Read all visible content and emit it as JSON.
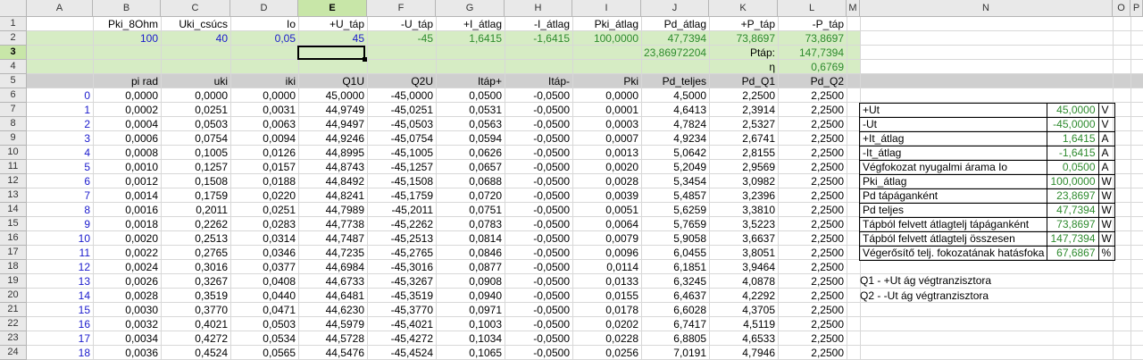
{
  "columns": [
    "A",
    "B",
    "C",
    "D",
    "E",
    "F",
    "G",
    "H",
    "I",
    "J",
    "K",
    "L",
    "M",
    "N",
    "O",
    "P"
  ],
  "rows": [
    "1",
    "2",
    "3",
    "4",
    "5",
    "6",
    "7",
    "8",
    "9",
    "10",
    "11",
    "12",
    "13",
    "14",
    "15",
    "16",
    "17",
    "18",
    "19",
    "20",
    "21",
    "22",
    "23",
    "24"
  ],
  "selected_column": "E",
  "selected_row": "3",
  "row1_headers": [
    "Pki_8Ohm",
    "Uki_csúcs",
    "Io",
    "+U_táp",
    "-U_táp",
    "+I_átlag",
    "-I_átlag",
    "Pki_átlag",
    "Pd_átlag",
    "+P_táp",
    "-P_táp"
  ],
  "row2_values": [
    "100",
    "40",
    "0,05",
    "45",
    "-45",
    "1,6415",
    "-1,6415",
    "100,0000",
    "47,7394",
    "73,8697",
    "73,8697"
  ],
  "row3": {
    "j": "23,86972204",
    "k_label": "Ptáp:",
    "l": "147,7394"
  },
  "row4": {
    "k_label": "η",
    "l": "0,6769"
  },
  "row5_headers": [
    "pi rad",
    "uki",
    "iki",
    "Q1U",
    "Q2U",
    "Itáp+",
    "Itáp-",
    "Pki",
    "Pd_teljes",
    "Pd_Q1",
    "Pd_Q2"
  ],
  "table_rows": [
    [
      "0",
      "0,0000",
      "0,0000",
      "0,0000",
      "45,0000",
      "-45,0000",
      "0,0500",
      "-0,0500",
      "0,0000",
      "4,5000",
      "2,2500",
      "2,2500"
    ],
    [
      "1",
      "0,0002",
      "0,0251",
      "0,0031",
      "44,9749",
      "-45,0251",
      "0,0531",
      "-0,0500",
      "0,0001",
      "4,6413",
      "2,3914",
      "2,2500"
    ],
    [
      "2",
      "0,0004",
      "0,0503",
      "0,0063",
      "44,9497",
      "-45,0503",
      "0,0563",
      "-0,0500",
      "0,0003",
      "4,7824",
      "2,5327",
      "2,2500"
    ],
    [
      "3",
      "0,0006",
      "0,0754",
      "0,0094",
      "44,9246",
      "-45,0754",
      "0,0594",
      "-0,0500",
      "0,0007",
      "4,9234",
      "2,6741",
      "2,2500"
    ],
    [
      "4",
      "0,0008",
      "0,1005",
      "0,0126",
      "44,8995",
      "-45,1005",
      "0,0626",
      "-0,0500",
      "0,0013",
      "5,0642",
      "2,8155",
      "2,2500"
    ],
    [
      "5",
      "0,0010",
      "0,1257",
      "0,0157",
      "44,8743",
      "-45,1257",
      "0,0657",
      "-0,0500",
      "0,0020",
      "5,2049",
      "2,9569",
      "2,2500"
    ],
    [
      "6",
      "0,0012",
      "0,1508",
      "0,0188",
      "44,8492",
      "-45,1508",
      "0,0688",
      "-0,0500",
      "0,0028",
      "5,3454",
      "3,0982",
      "2,2500"
    ],
    [
      "7",
      "0,0014",
      "0,1759",
      "0,0220",
      "44,8241",
      "-45,1759",
      "0,0720",
      "-0,0500",
      "0,0039",
      "5,4857",
      "3,2396",
      "2,2500"
    ],
    [
      "8",
      "0,0016",
      "0,2011",
      "0,0251",
      "44,7989",
      "-45,2011",
      "0,0751",
      "-0,0500",
      "0,0051",
      "5,6259",
      "3,3810",
      "2,2500"
    ],
    [
      "9",
      "0,0018",
      "0,2262",
      "0,0283",
      "44,7738",
      "-45,2262",
      "0,0783",
      "-0,0500",
      "0,0064",
      "5,7659",
      "3,5223",
      "2,2500"
    ],
    [
      "10",
      "0,0020",
      "0,2513",
      "0,0314",
      "44,7487",
      "-45,2513",
      "0,0814",
      "-0,0500",
      "0,0079",
      "5,9058",
      "3,6637",
      "2,2500"
    ],
    [
      "11",
      "0,0022",
      "0,2765",
      "0,0346",
      "44,7235",
      "-45,2765",
      "0,0846",
      "-0,0500",
      "0,0096",
      "6,0455",
      "3,8051",
      "2,2500"
    ],
    [
      "12",
      "0,0024",
      "0,3016",
      "0,0377",
      "44,6984",
      "-45,3016",
      "0,0877",
      "-0,0500",
      "0,0114",
      "6,1851",
      "3,9464",
      "2,2500"
    ],
    [
      "13",
      "0,0026",
      "0,3267",
      "0,0408",
      "44,6733",
      "-45,3267",
      "0,0908",
      "-0,0500",
      "0,0133",
      "6,3245",
      "4,0878",
      "2,2500"
    ],
    [
      "14",
      "0,0028",
      "0,3519",
      "0,0440",
      "44,6481",
      "-45,3519",
      "0,0940",
      "-0,0500",
      "0,0155",
      "6,4637",
      "4,2292",
      "2,2500"
    ],
    [
      "15",
      "0,0030",
      "0,3770",
      "0,0471",
      "44,6230",
      "-45,3770",
      "0,0971",
      "-0,0500",
      "0,0178",
      "6,6028",
      "4,3705",
      "2,2500"
    ],
    [
      "16",
      "0,0032",
      "0,4021",
      "0,0503",
      "44,5979",
      "-45,4021",
      "0,1003",
      "-0,0500",
      "0,0202",
      "6,7417",
      "4,5119",
      "2,2500"
    ],
    [
      "17",
      "0,0034",
      "0,4272",
      "0,0534",
      "44,5728",
      "-45,4272",
      "0,1034",
      "-0,0500",
      "0,0228",
      "6,8805",
      "4,6533",
      "2,2500"
    ],
    [
      "18",
      "0,0036",
      "0,4524",
      "0,0565",
      "44,5476",
      "-45,4524",
      "0,1065",
      "-0,0500",
      "0,0256",
      "7,0191",
      "4,7946",
      "2,2500"
    ]
  ],
  "summary": [
    {
      "label": "+Ut",
      "value": "45,0000",
      "unit": "V"
    },
    {
      "label": "-Ut",
      "value": "-45,0000",
      "unit": "V"
    },
    {
      "label": "+It_átlag",
      "value": "1,6415",
      "unit": "A"
    },
    {
      "label": "-It_átlag",
      "value": "-1,6415",
      "unit": "A"
    },
    {
      "label": "Végfokozat nyugalmi árama Io",
      "value": "0,0500",
      "unit": "A"
    },
    {
      "label": "Pki_átlag",
      "value": "100,0000",
      "unit": "W"
    },
    {
      "label": "Pd tápáganként",
      "value": "23,8697",
      "unit": "W"
    },
    {
      "label": "Pd teljes",
      "value": "47,7394",
      "unit": "W"
    },
    {
      "label": "Tápból felvett átlagtelj tápáganként",
      "value": "73,8697",
      "unit": "W"
    },
    {
      "label": "Tápból felvett átlagtelj összesen",
      "value": "147,7394",
      "unit": "W"
    },
    {
      "label": "Végerősítő telj. fokozatának hatásfoka",
      "value": "67,6867",
      "unit": "%"
    }
  ],
  "notes": [
    "Q1 - +Ut ág végtranzisztora",
    "Q2 - -Ut ág végtranzisztora"
  ],
  "colors": {
    "blue": "#1a1acc",
    "green": "#2d8a2d",
    "header_band": "#cfcfcf",
    "green_band": "#d6ecc4"
  }
}
